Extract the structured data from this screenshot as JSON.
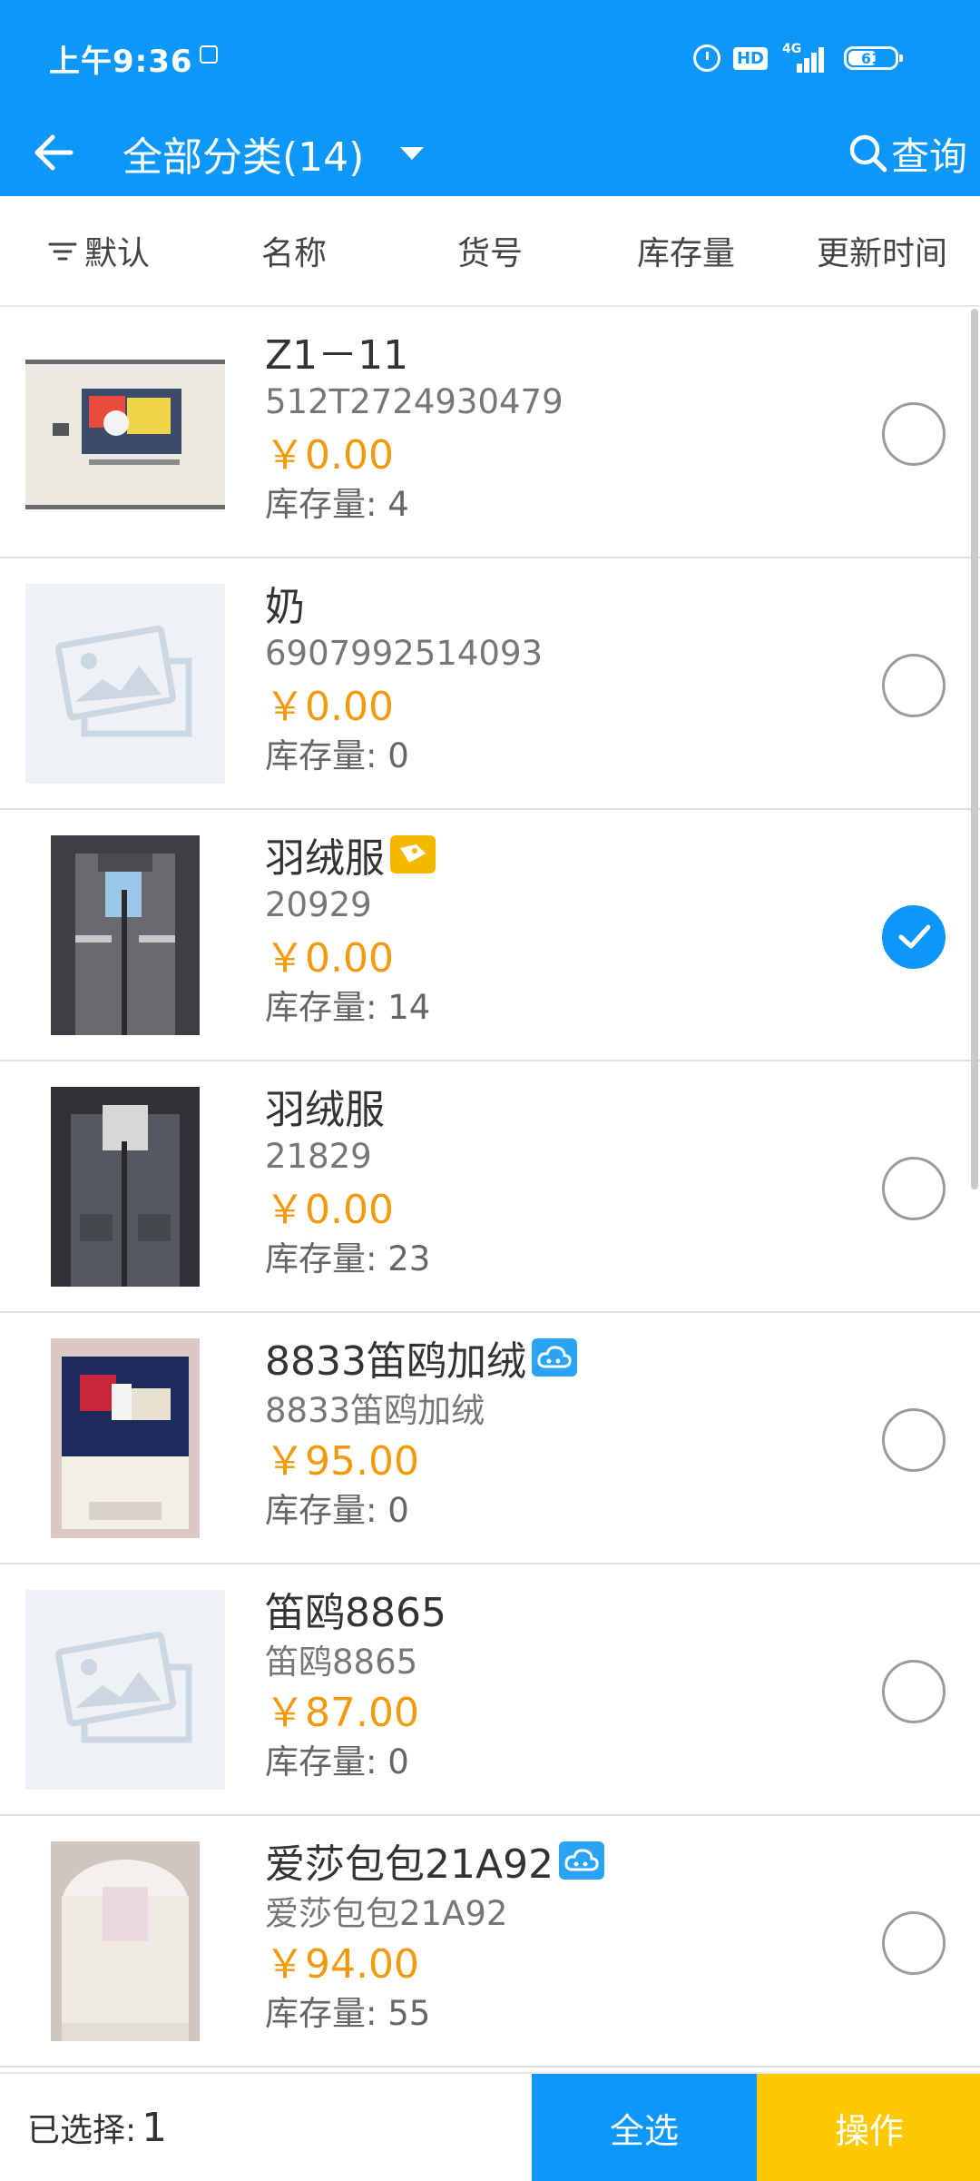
{
  "status_bar": {
    "time": "上午9:36",
    "hd": "HD",
    "network": "4G",
    "battery_level": "61"
  },
  "header": {
    "title": "全部分类(14)",
    "search_label": "查询"
  },
  "sort_bar": {
    "options": [
      "默认",
      "名称",
      "货号",
      "库存量",
      "更新时间"
    ]
  },
  "stock_prefix": "库存量: ",
  "products": [
    {
      "name": "Z1－11",
      "code": "512T2724930479",
      "price": "￥0.00",
      "stock": "库存量: 4",
      "image": "sweatshirt-photo",
      "badge": null,
      "checked": false
    },
    {
      "name": "奶",
      "code": "6907992514093",
      "price": "￥0.00",
      "stock": "库存量: 0",
      "image": "placeholder-image-icon",
      "badge": null,
      "checked": false
    },
    {
      "name": "羽绒服",
      "code": "20929",
      "price": "￥0.00",
      "stock": "库存量: 14",
      "image": "gray-down-jacket-photo",
      "badge": "gold-tag-icon",
      "checked": true
    },
    {
      "name": "羽绒服",
      "code": "21829",
      "price": "￥0.00",
      "stock": "库存量: 23",
      "image": "gray-down-jacket-photo",
      "badge": null,
      "checked": false
    },
    {
      "name": "8833笛鸥加绒",
      "code": "8833笛鸥加绒",
      "price": "￥95.00",
      "stock": "库存量: 0",
      "image": "colorful-jacket-photo",
      "badge": "blue-cloud-icon",
      "checked": false
    },
    {
      "name": "笛鸥8865",
      "code": "笛鸥8865",
      "price": "￥87.00",
      "stock": "库存量: 0",
      "image": "placeholder-image-icon",
      "badge": null,
      "checked": false
    },
    {
      "name": "爱莎包包21A92",
      "code": "爱莎包包21A92",
      "price": "￥94.00",
      "stock": "库存量: 55",
      "image": "white-fur-coat-photo",
      "badge": "blue-cloud-icon",
      "checked": false
    }
  ],
  "bottom_bar": {
    "selected_label": "已选择:",
    "selected_count": "1",
    "select_all_label": "全选",
    "operate_label": "操作"
  },
  "colors": {
    "primary": "#0d97f8",
    "price": "#f29a0e",
    "operate_button": "#fcc800"
  }
}
